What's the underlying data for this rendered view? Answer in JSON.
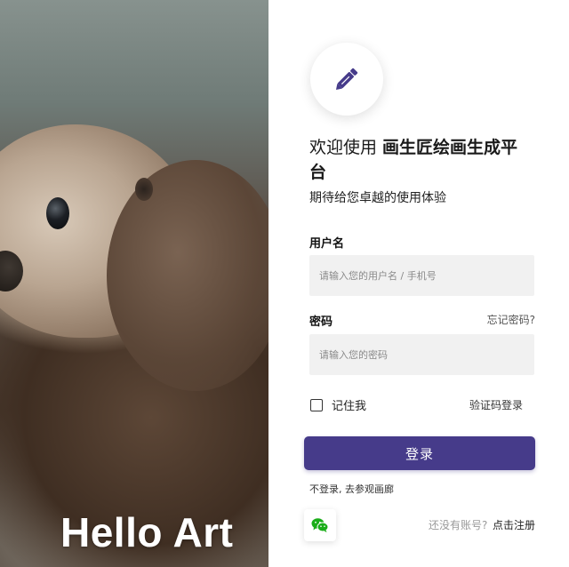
{
  "hero": {
    "title": "Hello Art"
  },
  "login": {
    "welcome_prefix": "欢迎使用 ",
    "brand_name": "画生匠绘画生成平台",
    "subtitle": "期待给您卓越的使用体验",
    "username_label": "用户名",
    "username_placeholder": "请输入您的用户名 / 手机号",
    "username_value": "",
    "password_label": "密码",
    "forgot_password": "忘记密码?",
    "password_placeholder": "请输入您的密码",
    "password_value": "",
    "remember_me": "记住我",
    "remember_checked": false,
    "code_login": "验证码登录",
    "submit_label": "登录",
    "guest_link": "不登录, 去参观画廊",
    "no_account": "还没有账号?",
    "register_link": "点击注册"
  },
  "icons": {
    "logo": "pen-icon",
    "social": "wechat-icon"
  },
  "colors": {
    "primary": "#463b8a",
    "input_bg": "#f1f1f1",
    "wechat": "#1aad19"
  }
}
